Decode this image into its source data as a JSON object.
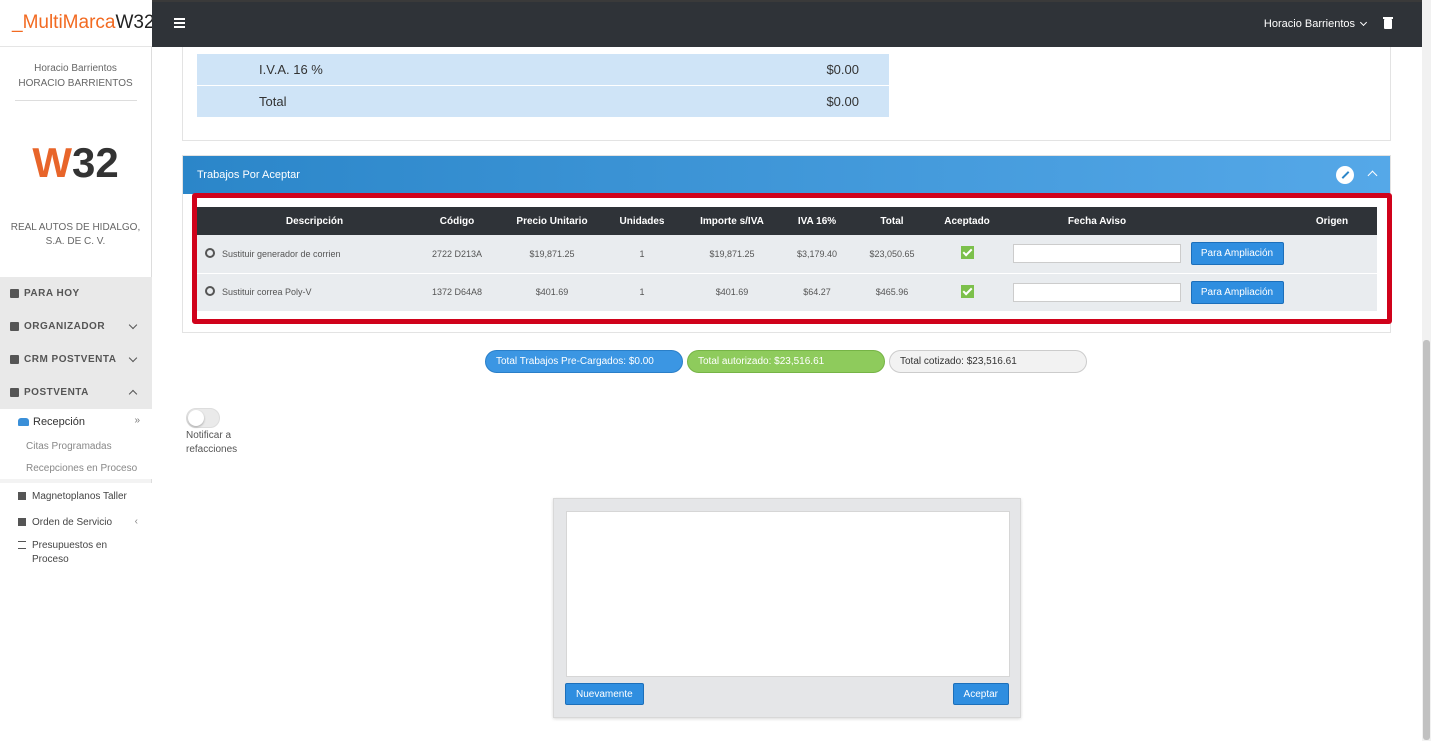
{
  "brand": {
    "part1": "_MultiMarca",
    "part2": "W32"
  },
  "topbar": {
    "user_name": "Horacio Barrientos"
  },
  "sidebar": {
    "user_line1": "Horacio Barrientos",
    "user_line2": "HORACIO BARRIENTOS",
    "logo_w": "W",
    "logo_num": "32",
    "company": "REAL AUTOS DE HIDALGO, S.A. DE C. V.",
    "menu": {
      "para_hoy": "PARA HOY",
      "organizador": "ORGANIZADOR",
      "crm": "CRM POSTVENTA",
      "postventa": "POSTVENTA",
      "recepcion": "Recepción",
      "citas": "Citas Programadas",
      "recepciones": "Recepciones en Proceso",
      "magnetoplanos": "Magnetoplanos Taller",
      "orden": "Orden de Servicio",
      "presupuestos": "Presupuestos en Proceso"
    }
  },
  "totals": [
    {
      "label": "I.V.A. 16 %",
      "value": "$0.00"
    },
    {
      "label": "Total",
      "value": "$0.00"
    }
  ],
  "trabajos": {
    "title": "Trabajos Por Aceptar",
    "columns": [
      "Descripción",
      "Código",
      "Precio Unitario",
      "Unidades",
      "Importe s/IVA",
      "IVA 16%",
      "Total",
      "Aceptado",
      "Fecha Aviso",
      "Origen"
    ],
    "rows": [
      {
        "desc": "Sustituir generador de corrien",
        "codigo": "2722 D213A",
        "precio": "$19,871.25",
        "unidades": "1",
        "importe": "$19,871.25",
        "iva": "$3,179.40",
        "total": "$23,050.65",
        "aceptado": true,
        "fecha": "",
        "action": "Para Ampliación"
      },
      {
        "desc": "Sustituir correa Poly-V",
        "codigo": "1372 D64A8",
        "precio": "$401.69",
        "unidades": "1",
        "importe": "$401.69",
        "iva": "$64.27",
        "total": "$465.96",
        "aceptado": true,
        "fecha": "",
        "action": "Para Ampliación"
      }
    ]
  },
  "summary": {
    "precargados": "Total Trabajos Pre-Cargados: $0.00",
    "autorizado": "Total autorizado: $23,516.61",
    "cotizado": "Total cotizado: $23,516.61"
  },
  "notify": {
    "label": "Notificar a refacciones",
    "on": false
  },
  "signature": {
    "again": "Nuevamente",
    "accept": "Aceptar"
  },
  "colors": {
    "accent": "#2f8ee0",
    "topbar": "#2f3338",
    "highlight": "#d0021b",
    "brand": "#f26a21"
  }
}
